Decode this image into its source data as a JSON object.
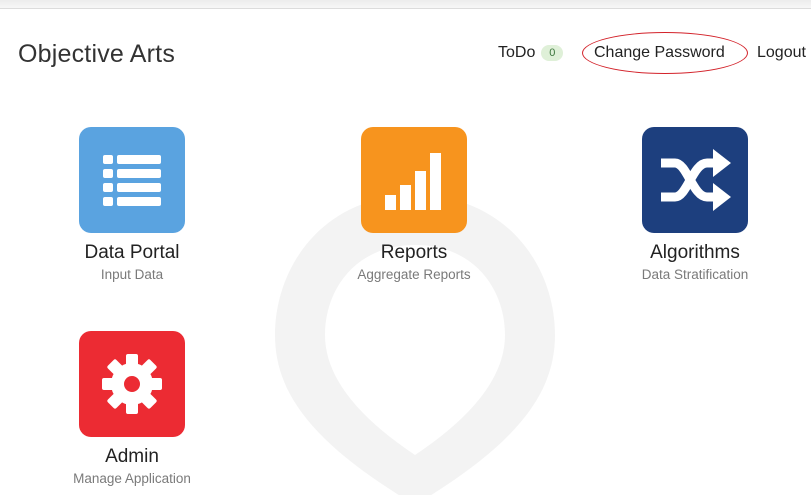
{
  "app": {
    "brand": "Objective Arts"
  },
  "nav": {
    "todo_label": "ToDo",
    "todo_count": "0",
    "change_password_label": "Change Password",
    "logout_label": "Logout"
  },
  "tiles": [
    {
      "title": "Data Portal",
      "subtitle": "Input Data",
      "icon": "list-icon",
      "color": "#5aa3e0"
    },
    {
      "title": "Reports",
      "subtitle": "Aggregate Reports",
      "icon": "bar-chart-icon",
      "color": "#f7941e"
    },
    {
      "title": "Algorithms",
      "subtitle": "Data Stratification",
      "icon": "shuffle-icon",
      "color": "#1d3f7e"
    },
    {
      "title": "Admin",
      "subtitle": "Manage Application",
      "icon": "gear-icon",
      "color": "#ec2b33"
    }
  ],
  "colors": {
    "highlight_ellipse": "#d3222a",
    "todo_badge_bg": "#dff0d8"
  }
}
